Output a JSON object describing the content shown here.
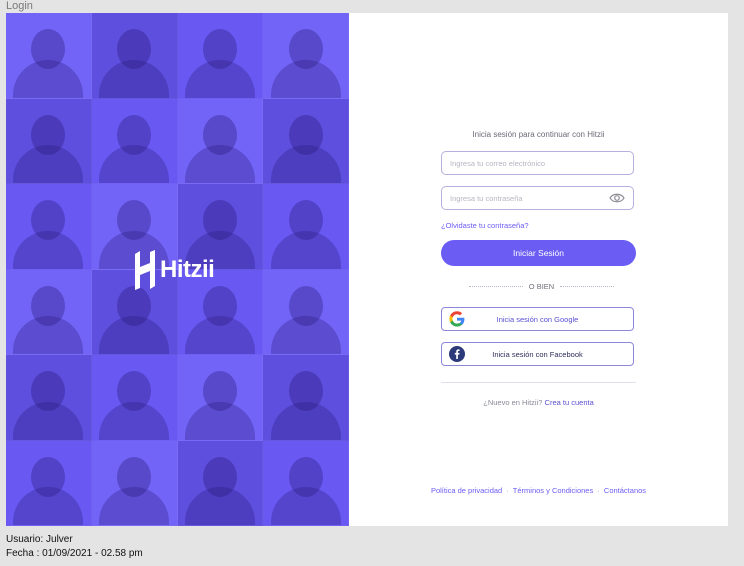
{
  "window": {
    "title": "Login"
  },
  "brand": {
    "name": "Hitzii",
    "accent": "#6B5CF4"
  },
  "login": {
    "subtitle": "Inicia sesión para continuar con Hitzii",
    "email_placeholder": "Ingresa tu correo electrónico",
    "password_placeholder": "Ingresa tu contraseña",
    "forgot_label": "¿Olvidaste tu contraseña?",
    "submit_label": "Iniciar Sesión",
    "divider_label": "O BIEN",
    "google_label": "Inicia sesión con Google",
    "facebook_label": "Inicia sesión con Facebook",
    "signup_prompt": "¿Nuevo en Hitzii?",
    "signup_link": "Crea tu cuenta"
  },
  "footer": {
    "privacy": "Política de privacidad",
    "terms": "Términos y Condiciones",
    "contact": "Contáctanos",
    "separator": "·"
  },
  "meta": {
    "user": "Usuario: Julver",
    "date": "Fecha : 01/09/2021 - 02.58 pm"
  },
  "icons": {
    "password_toggle": "eye-icon",
    "google": "google-icon",
    "facebook": "facebook-icon",
    "logo": "hitzii-logo-mark"
  }
}
